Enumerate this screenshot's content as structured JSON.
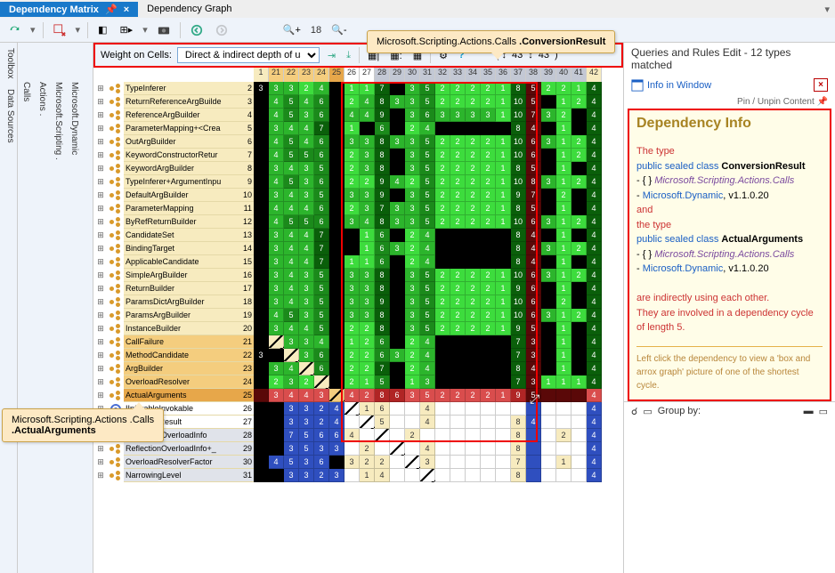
{
  "tabs": {
    "matrix": "Dependency Matrix",
    "graph": "Dependency Graph"
  },
  "vtabs": {
    "toolbox": "Toolbox",
    "data": "Data Sources"
  },
  "tree": {
    "calls": "Calls",
    "actions": "Actions .",
    "scripting": "Microsoft.Scripting .",
    "dynamic": "Microsoft.Dynamic"
  },
  "weight": {
    "label": "Weight on Cells:",
    "selected": "Direct & indirect depth of use"
  },
  "zoom": "18",
  "toolbar_spinners": {
    "left": "43",
    "right": "43"
  },
  "col_numbers": [
    "1",
    "21",
    "22",
    "23",
    "24",
    "25",
    "26",
    "27",
    "28",
    "29",
    "30",
    "31",
    "32",
    "33",
    "34",
    "35",
    "36",
    "37",
    "38",
    "39",
    "40",
    "41",
    "42"
  ],
  "rows": [
    {
      "name": "TypeInferer",
      "num": "2",
      "hl": "",
      "cells": [
        "3",
        "3",
        "3",
        "2",
        "4",
        "",
        "1",
        "1",
        "7",
        "",
        "3",
        "5",
        "2",
        "2",
        "2",
        "2",
        "1",
        "8",
        "5",
        "2",
        "2",
        "1",
        "4"
      ]
    },
    {
      "name": "ReturnReferenceArgBuilde",
      "num": "3",
      "hl": "",
      "cells": [
        "",
        "4",
        "5",
        "4",
        "6",
        "",
        "2",
        "4",
        "8",
        "3",
        "3",
        "5",
        "2",
        "2",
        "2",
        "2",
        "1",
        "10",
        "5",
        "",
        "1",
        "2",
        "4"
      ]
    },
    {
      "name": "ReferenceArgBuilder",
      "num": "4",
      "hl": "",
      "cells": [
        "",
        "4",
        "5",
        "3",
        "6",
        "",
        "4",
        "4",
        "9",
        "",
        "3",
        "6",
        "3",
        "3",
        "3",
        "3",
        "1",
        "10",
        "7",
        "3",
        "2",
        "",
        "4"
      ]
    },
    {
      "name": "ParameterMapping+<Crea",
      "num": "5",
      "hl": "",
      "cells": [
        "",
        "3",
        "4",
        "4",
        "7",
        "",
        "1",
        "",
        "6",
        "",
        "2",
        "4",
        "",
        "",
        "",
        "",
        "",
        "8",
        "4",
        "",
        "1",
        "",
        "4"
      ]
    },
    {
      "name": "OutArgBuilder",
      "num": "6",
      "hl": "",
      "cells": [
        "",
        "4",
        "5",
        "4",
        "6",
        "",
        "3",
        "3",
        "8",
        "3",
        "3",
        "5",
        "2",
        "2",
        "2",
        "2",
        "1",
        "10",
        "6",
        "3",
        "1",
        "2",
        "4"
      ]
    },
    {
      "name": "KeywordConstructorRetur",
      "num": "7",
      "hl": "",
      "cells": [
        "",
        "4",
        "5",
        "5",
        "6",
        "",
        "2",
        "3",
        "8",
        "",
        "3",
        "5",
        "2",
        "2",
        "2",
        "2",
        "1",
        "10",
        "6",
        "",
        "1",
        "2",
        "4"
      ]
    },
    {
      "name": "KeywordArgBuilder",
      "num": "8",
      "hl": "",
      "cells": [
        "",
        "3",
        "4",
        "3",
        "5",
        "",
        "2",
        "3",
        "8",
        "",
        "3",
        "5",
        "2",
        "2",
        "2",
        "2",
        "1",
        "8",
        "5",
        "",
        "1",
        "",
        "4"
      ]
    },
    {
      "name": "TypeInferer+ArgumentInpu",
      "num": "9",
      "hl": "",
      "cells": [
        "",
        "4",
        "5",
        "3",
        "6",
        "",
        "2",
        "2",
        "9",
        "4",
        "2",
        "5",
        "2",
        "2",
        "2",
        "2",
        "1",
        "10",
        "8",
        "3",
        "1",
        "2",
        "4"
      ]
    },
    {
      "name": "DefaultArgBuilder",
      "num": "10",
      "hl": "",
      "cells": [
        "",
        "3",
        "4",
        "3",
        "5",
        "",
        "3",
        "3",
        "9",
        "",
        "3",
        "5",
        "2",
        "2",
        "2",
        "2",
        "1",
        "9",
        "7",
        "",
        "2",
        "",
        "4"
      ]
    },
    {
      "name": "ParameterMapping",
      "num": "11",
      "hl": "",
      "cells": [
        "",
        "4",
        "4",
        "4",
        "6",
        "",
        "2",
        "3",
        "7",
        "3",
        "3",
        "5",
        "2",
        "2",
        "2",
        "2",
        "1",
        "8",
        "5",
        "",
        "1",
        "",
        "4"
      ]
    },
    {
      "name": "ByRefReturnBuilder",
      "num": "12",
      "hl": "",
      "cells": [
        "",
        "4",
        "5",
        "5",
        "6",
        "",
        "3",
        "4",
        "8",
        "3",
        "3",
        "5",
        "2",
        "2",
        "2",
        "2",
        "1",
        "10",
        "6",
        "3",
        "1",
        "2",
        "4"
      ]
    },
    {
      "name": "CandidateSet",
      "num": "13",
      "hl": "",
      "cells": [
        "",
        "3",
        "4",
        "4",
        "7",
        "",
        "",
        "1",
        "6",
        "",
        "2",
        "4",
        "",
        "",
        "",
        "",
        "",
        "8",
        "4",
        "",
        "1",
        "",
        "4"
      ]
    },
    {
      "name": "BindingTarget",
      "num": "14",
      "hl": "",
      "cells": [
        "",
        "3",
        "4",
        "4",
        "7",
        "",
        "",
        "1",
        "6",
        "3",
        "2",
        "4",
        "",
        "",
        "",
        "",
        "",
        "8",
        "4",
        "3",
        "1",
        "2",
        "4"
      ]
    },
    {
      "name": "ApplicableCandidate",
      "num": "15",
      "hl": "",
      "cells": [
        "",
        "3",
        "4",
        "4",
        "7",
        "",
        "1",
        "1",
        "6",
        "",
        "2",
        "4",
        "",
        "",
        "",
        "",
        "",
        "8",
        "4",
        "",
        "1",
        "",
        "4"
      ]
    },
    {
      "name": "SimpleArgBuilder",
      "num": "16",
      "hl": "",
      "cells": [
        "",
        "3",
        "4",
        "3",
        "5",
        "",
        "3",
        "3",
        "8",
        "",
        "3",
        "5",
        "2",
        "2",
        "2",
        "2",
        "1",
        "10",
        "6",
        "3",
        "1",
        "2",
        "4"
      ]
    },
    {
      "name": "ReturnBuilder",
      "num": "17",
      "hl": "",
      "cells": [
        "",
        "3",
        "4",
        "3",
        "5",
        "",
        "3",
        "3",
        "8",
        "",
        "3",
        "5",
        "2",
        "2",
        "2",
        "2",
        "1",
        "9",
        "6",
        "",
        "1",
        "",
        "4"
      ]
    },
    {
      "name": "ParamsDictArgBuilder",
      "num": "18",
      "hl": "",
      "cells": [
        "",
        "3",
        "4",
        "3",
        "5",
        "",
        "3",
        "3",
        "9",
        "",
        "3",
        "5",
        "2",
        "2",
        "2",
        "2",
        "1",
        "10",
        "6",
        "",
        "2",
        "",
        "4"
      ]
    },
    {
      "name": "ParamsArgBuilder",
      "num": "19",
      "hl": "",
      "cells": [
        "",
        "4",
        "5",
        "3",
        "5",
        "",
        "3",
        "3",
        "8",
        "",
        "3",
        "5",
        "2",
        "2",
        "2",
        "2",
        "1",
        "10",
        "6",
        "3",
        "1",
        "2",
        "4"
      ]
    },
    {
      "name": "InstanceBuilder",
      "num": "20",
      "hl": "",
      "cells": [
        "",
        "3",
        "4",
        "4",
        "5",
        "",
        "2",
        "2",
        "8",
        "",
        "3",
        "5",
        "2",
        "2",
        "2",
        "2",
        "1",
        "9",
        "5",
        "",
        "1",
        "",
        "4"
      ]
    },
    {
      "name": "CallFailure",
      "num": "21",
      "hl": "hl",
      "diag": 0,
      "cells": [
        "",
        "",
        "3",
        "3",
        "4",
        "",
        "1",
        "2",
        "6",
        "",
        "2",
        "4",
        "",
        "",
        "",
        "",
        "",
        "7",
        "3",
        "",
        "1",
        "",
        "4"
      ]
    },
    {
      "name": "MethodCandidate",
      "num": "22",
      "hl": "hl",
      "diag": 1,
      "cells": [
        "3",
        "",
        "",
        "3",
        "6",
        "",
        "2",
        "2",
        "6",
        "3",
        "2",
        "4",
        "",
        "",
        "",
        "",
        "",
        "7",
        "3",
        "",
        "1",
        "",
        "4"
      ]
    },
    {
      "name": "ArgBuilder",
      "num": "23",
      "hl": "hl",
      "diag": 2,
      "cells": [
        "",
        "3",
        "4",
        "",
        "6",
        "",
        "2",
        "2",
        "7",
        "",
        "2",
        "4",
        "",
        "",
        "",
        "",
        "",
        "8",
        "4",
        "",
        "1",
        "",
        "4"
      ]
    },
    {
      "name": "OverloadResolver",
      "num": "24",
      "hl": "hl",
      "diag": 3,
      "cells": [
        "",
        "2",
        "3",
        "2",
        "",
        "",
        "2",
        "1",
        "5",
        "",
        "1",
        "3",
        "",
        "",
        "",
        "",
        "",
        "7",
        "3",
        "1",
        "1",
        "1",
        "4"
      ]
    },
    {
      "name": "ActualArguments",
      "num": "25",
      "hl": "hl2",
      "diag": 4,
      "rowstyle": "r",
      "cells": [
        "",
        "3",
        "4",
        "4",
        "3",
        "",
        "4",
        "2",
        "8",
        "6",
        "3",
        "5",
        "2",
        "2",
        "2",
        "2",
        "1",
        "9",
        "5",
        "",
        "",
        "",
        "4"
      ]
    },
    {
      "name": "IInferableInvokable",
      "num": "26",
      "hl": "hl3",
      "diag": 5,
      "cells": [
        "",
        "",
        "3",
        "3",
        "2",
        "4",
        "",
        "1",
        "6",
        "",
        "",
        "4",
        "",
        "",
        "",
        "",
        "",
        "",
        "",
        "",
        "",
        "",
        "4"
      ]
    },
    {
      "name": "InferenceResult",
      "num": "27",
      "hl": "hl3",
      "diag": 6,
      "cells": [
        "",
        "",
        "3",
        "3",
        "2",
        "4",
        "",
        "",
        "5",
        "",
        "",
        "4",
        "",
        "",
        "",
        "",
        "",
        "8",
        "4",
        "",
        "",
        "",
        "4"
      ]
    },
    {
      "name": "ReflectionOverloadInfo",
      "num": "28",
      "hl": "hlg",
      "diag": 7,
      "cells": [
        "",
        "",
        "7",
        "5",
        "6",
        "6",
        "4",
        "",
        "",
        "",
        "2",
        "",
        "",
        "",
        "",
        "",
        "",
        "8",
        "",
        "",
        "2",
        "",
        "4"
      ]
    },
    {
      "name": "ReflectionOverloadInfo+_",
      "num": "29",
      "hl": "hlg",
      "diag": 8,
      "cells": [
        "",
        "",
        "3",
        "5",
        "3",
        "3",
        "",
        "2",
        "",
        "",
        "",
        "4",
        "",
        "",
        "",
        "",
        "",
        "8",
        "",
        "",
        "",
        "",
        "4"
      ]
    },
    {
      "name": "OverloadResolverFactor",
      "num": "30",
      "hl": "hlg",
      "diag": 9,
      "cells": [
        "",
        "4",
        "5",
        "3",
        "6",
        "",
        "3",
        "2",
        "2",
        "",
        "",
        "3",
        "",
        "",
        "",
        "",
        "",
        "7",
        "",
        "",
        "1",
        "",
        "4"
      ]
    },
    {
      "name": "NarrowingLevel",
      "num": "31",
      "hl": "hlg",
      "diag": 10,
      "cells": [
        "",
        "",
        "3",
        "3",
        "2",
        "3",
        "",
        "1",
        "4",
        "",
        "",
        "",
        "",
        "",
        "",
        "",
        "",
        "8",
        "",
        "",
        "",
        "",
        "4"
      ]
    }
  ],
  "tooltips": {
    "top": {
      "pre": "Microsoft.Scripting.Actions.Calls ",
      "bold": ".ConversionResult"
    },
    "left": {
      "pre": "Microsoft.Scripting.Actions .Calls ",
      "bold": ".ActualArguments"
    }
  },
  "right": {
    "header": "Queries and Rules Edit  - 12 types matched",
    "link": "Info in Window",
    "pin": "Pin / Unpin Content",
    "title": "Dependency Info",
    "thetype1": "The type",
    "cls_pre1": "public sealed class ",
    "cls_name1": "ConversionResult",
    "ns": "- { } ",
    "ns_txt": "Microsoft.Scripting.Actions.Calls",
    "asm_pre": "- ",
    "asm_txt": "Microsoft.Dynamic",
    "asm_ver": ", v1.1.0.20",
    "and": " and",
    "thetype2": "the type",
    "cls_name2": "ActualArguments",
    "ind": "are indirectly using each other.",
    "cycle": "They are involved in a dependency cycle of length 5.",
    "foot": "Left click the dependency to view a 'box and arrox graph' picture of one of the shortest cycle.",
    "groupby": "Group by:"
  }
}
